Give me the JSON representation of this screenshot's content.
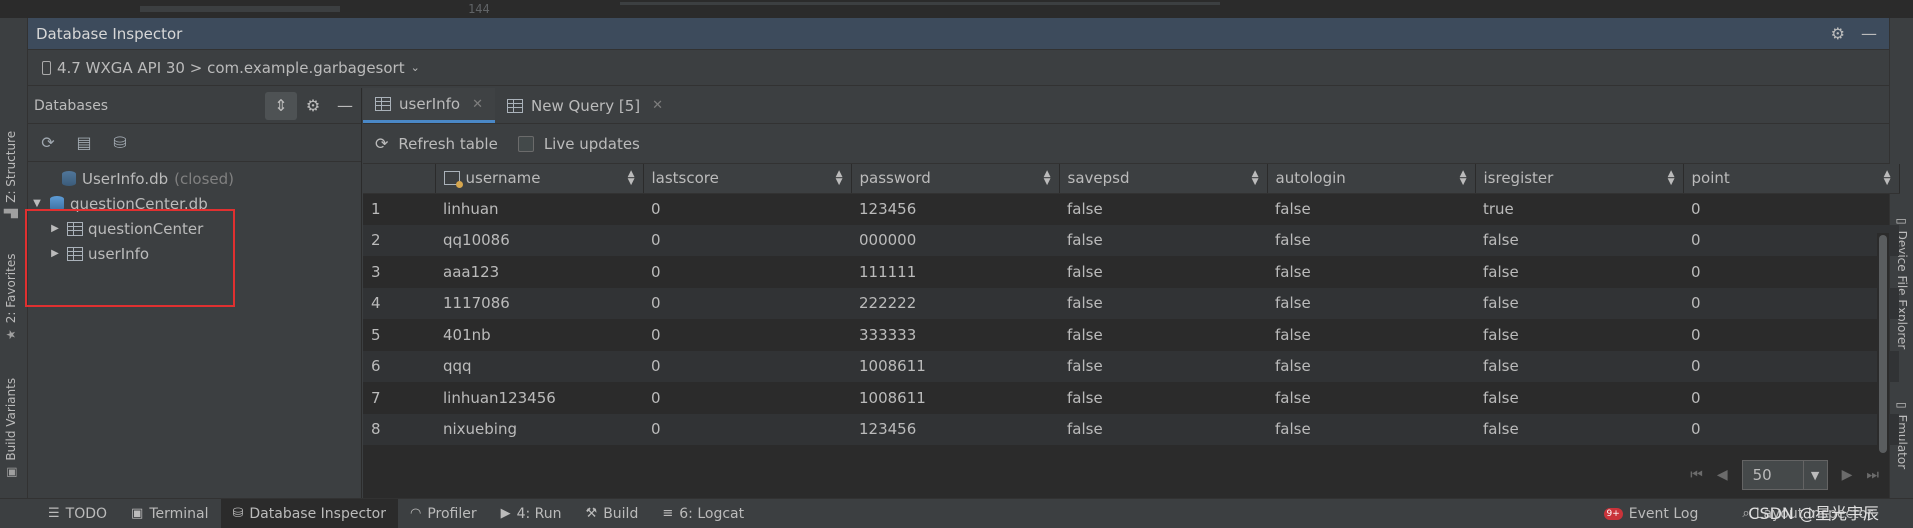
{
  "editor_fragment": {
    "line_number": "144"
  },
  "left_tool_tabs": [
    {
      "label": "Z: Structure",
      "icon": "structure-icon"
    },
    {
      "label": "2: Favorites",
      "icon": "star-icon"
    },
    {
      "label": "Build Variants",
      "icon": "build-variants-icon"
    }
  ],
  "right_tool_tabs": [
    {
      "label": "Device File Explorer",
      "icon": "device-icon"
    },
    {
      "label": "Emulator",
      "icon": "emulator-icon"
    }
  ],
  "inspector": {
    "title": "Database Inspector",
    "device": "4.7 WXGA API 30 > com.example.garbagesort"
  },
  "databases": {
    "header": "Databases",
    "tree": [
      {
        "label": "UserInfo.db",
        "note": "(closed)",
        "level": 0
      },
      {
        "label": "questionCenter.db",
        "level": 0,
        "expanded": true
      },
      {
        "label": "questionCenter",
        "level": 1
      },
      {
        "label": "userInfo",
        "level": 1
      }
    ]
  },
  "tabs": [
    {
      "label": "userInfo",
      "active": true
    },
    {
      "label": "New Query [5]",
      "active": false
    }
  ],
  "actions": {
    "refresh_label": "Refresh table",
    "live_updates_label": "Live updates"
  },
  "table": {
    "columns": [
      "username",
      "lastscore",
      "password",
      "savepsd",
      "autologin",
      "isregister",
      "point"
    ],
    "rows": [
      [
        "1",
        "linhuan",
        "0",
        "123456",
        "false",
        "false",
        "true",
        "0"
      ],
      [
        "2",
        "qq10086",
        "0",
        "000000",
        "false",
        "false",
        "false",
        "0"
      ],
      [
        "3",
        "aaa123",
        "0",
        "111111",
        "false",
        "false",
        "false",
        "0"
      ],
      [
        "4",
        "1117086",
        "0",
        "222222",
        "false",
        "false",
        "false",
        "0"
      ],
      [
        "5",
        "401nb",
        "0",
        "333333",
        "false",
        "false",
        "false",
        "0"
      ],
      [
        "6",
        "qqq",
        "0",
        "1008611",
        "false",
        "false",
        "false",
        "0"
      ],
      [
        "7",
        "linhuan123456",
        "0",
        "1008611",
        "false",
        "false",
        "false",
        "0"
      ],
      [
        "8",
        "nixuebing",
        "0",
        "123456",
        "false",
        "false",
        "false",
        "0"
      ]
    ]
  },
  "pager": {
    "page_size": "50"
  },
  "status_bar": {
    "items": [
      {
        "label": "TODO",
        "icon": "todo-icon"
      },
      {
        "label": "Terminal",
        "icon": "terminal-icon"
      },
      {
        "label": "Database Inspector",
        "icon": "database-icon",
        "active": true
      },
      {
        "label": "Profiler",
        "icon": "profiler-icon"
      },
      {
        "label": "4: Run",
        "icon": "run-icon"
      },
      {
        "label": "Build",
        "icon": "build-icon"
      },
      {
        "label": "6: Logcat",
        "icon": "logcat-icon"
      }
    ],
    "event_log": "Event Log",
    "event_badge": "9+",
    "layout_inspector": "Layout Inspector"
  },
  "watermark": "CSDN @星光宇辰",
  "colors": {
    "accent": "#4a88c7",
    "highlight": "#e03030",
    "title_bar": "#3d4b5c"
  }
}
